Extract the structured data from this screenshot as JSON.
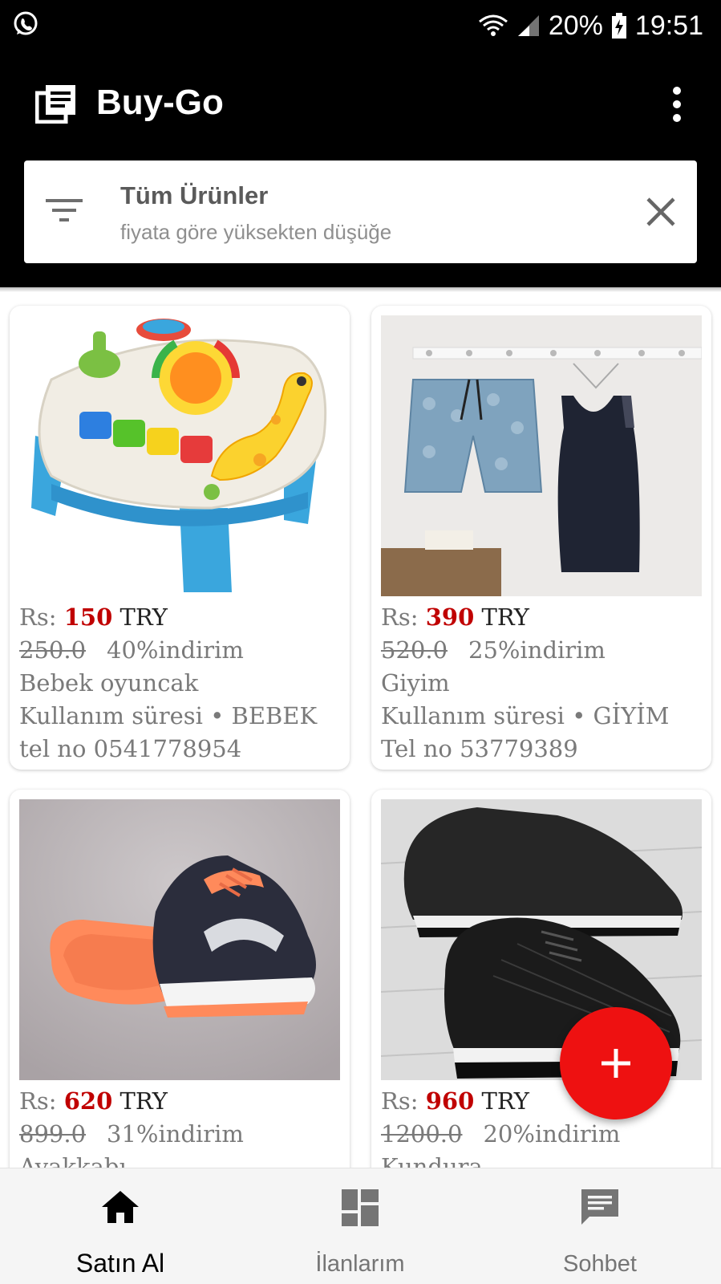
{
  "status_bar": {
    "battery": "20%",
    "time": "19:51",
    "icons": [
      "whatsapp-icon",
      "wifi-icon",
      "signal-icon",
      "battery-charging-icon"
    ]
  },
  "app_bar": {
    "title": "Buy-Go",
    "icon": "list-app-icon",
    "menu_icon": "more-vert-icon"
  },
  "filter": {
    "title": "Tüm Ürünler",
    "subtitle": "fiyata göre yüksekten düşüğe",
    "filter_icon": "filter-icon",
    "clear_icon": "close-icon"
  },
  "currency_prefix": "Rs:",
  "currency": "TRY",
  "products": [
    {
      "price": "150",
      "old_price": "250.0",
      "discount": "40%indirim",
      "name": "Bebek oyuncak",
      "usage": "Kullanım süresi",
      "separator": "•",
      "category": "BEBEK",
      "phone": "tel no 0541778954"
    },
    {
      "price": "390",
      "old_price": "520.0",
      "discount": "25%indirim",
      "name": "Giyim",
      "usage": "Kullanım süresi",
      "separator": "•",
      "category": "GİYİM",
      "phone": "Tel no 53779389"
    },
    {
      "price": "620",
      "old_price": "899.0",
      "discount": "31%indirim",
      "name": "Ayakkabı"
    },
    {
      "price": "960",
      "old_price": "1200.0",
      "discount": "20%indirim",
      "name": "Kundura"
    }
  ],
  "fab": {
    "icon": "add-icon"
  },
  "bottom_nav": [
    {
      "label": "Satın Al",
      "icon": "home-icon",
      "active": true
    },
    {
      "label": "İlanlarım",
      "icon": "dashboard-icon",
      "active": false
    },
    {
      "label": "Sohbet",
      "icon": "chat-icon",
      "active": false
    }
  ],
  "colors": {
    "primary": "#000000",
    "price": "#c00000",
    "fab": "#ee1111",
    "nav_background": "#f5f5f5"
  }
}
